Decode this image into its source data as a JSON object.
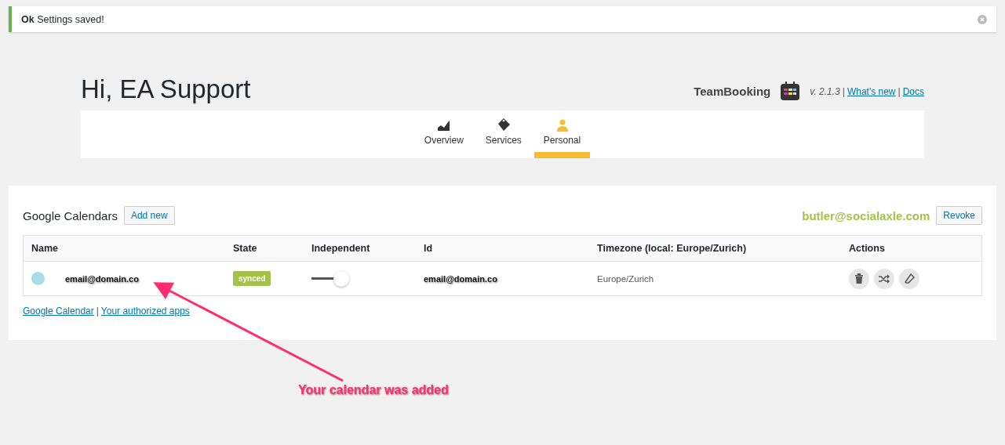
{
  "notice": {
    "label": "Ok",
    "message": "Settings saved!"
  },
  "greeting": "Hi, EA Support",
  "brand": {
    "name": "TeamBooking",
    "parts": [
      {
        "kind": "text",
        "text": "v. 2.1.3"
      },
      {
        "kind": "separator",
        "text": "|"
      },
      {
        "kind": "link",
        "text": "What's new"
      },
      {
        "kind": "separator",
        "text": "|"
      },
      {
        "kind": "link",
        "text": "Docs"
      }
    ]
  },
  "tabs": [
    {
      "label": "Overview",
      "selected": false
    },
    {
      "label": "Services",
      "selected": false
    },
    {
      "label": "Personal",
      "selected": true
    }
  ],
  "section": {
    "title": "Google Calendars",
    "add_button": "Add new",
    "account": "butler@socialaxle.com",
    "revoke_button": "Revoke"
  },
  "table": {
    "columns": [
      "Name",
      "State",
      "Independent",
      "Id",
      "Timezone (local: Europe/Zurich)",
      "Actions"
    ],
    "rows": [
      {
        "color": "#a8dde5",
        "name": "email@domain.co",
        "state": "synced",
        "independent": true,
        "id": "email@domain.co",
        "timezone": "Europe/Zurich"
      }
    ]
  },
  "footer": [
    {
      "kind": "link",
      "text": "Google Calendar"
    },
    {
      "kind": "separator",
      "text": "|"
    },
    {
      "kind": "link",
      "text": "Your authorized apps"
    }
  ],
  "annotation": "Your calendar was added"
}
